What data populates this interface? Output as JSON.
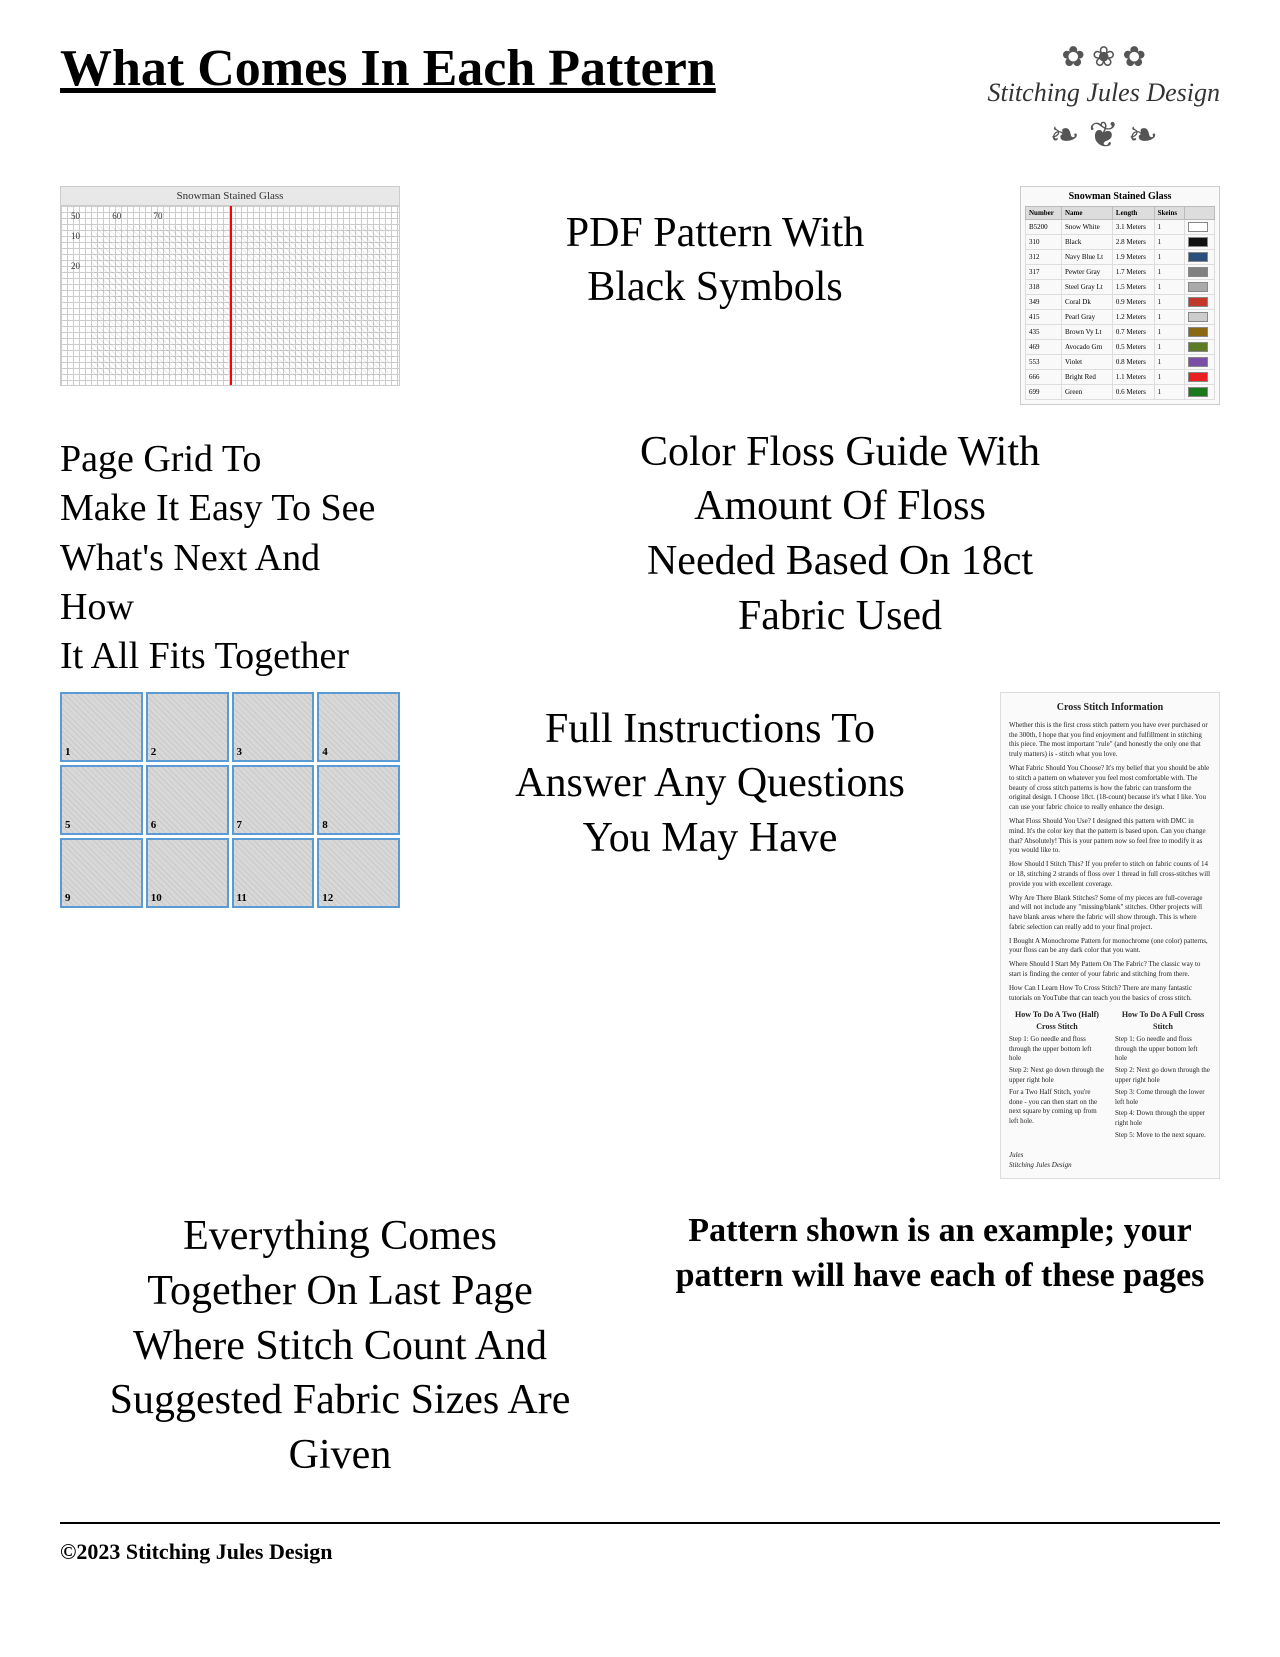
{
  "header": {
    "title": "What Comes In Each Pattern",
    "brand": {
      "name": "Stitching Jules Design",
      "decoration": "❧ ❦ ❧"
    }
  },
  "sections": {
    "pdf_pattern": {
      "label": "PDF Pattern With\nBlack Symbols",
      "preview_title": "Snowman Stained Glass"
    },
    "color_floss": {
      "label": "Color Floss Guide With\nAmount Of Floss\nNeeded Based On 18ct\nFabric Used"
    },
    "page_grid": {
      "label": "Page Grid To\nMake It Easy To See\nWhat's Next And How\nIt All Fits Together"
    },
    "instructions": {
      "label": "Full Instructions To\nAnswer Any Questions\nYou May Have"
    },
    "everything": {
      "label": "Everything Comes\nTogether On Last Page\nWhere Stitch Count And\nSuggested Fabric Sizes Are\nGiven"
    },
    "pattern_example": {
      "label": "Pattern shown is an example; your pattern will have each of these pages"
    }
  },
  "thumbnails": {
    "numbers": [
      "1",
      "2",
      "3",
      "4",
      "5",
      "6",
      "7",
      "8",
      "9",
      "10",
      "11",
      "12"
    ]
  },
  "floss_table": {
    "title": "Snowman Stained Glass",
    "headers": [
      "Number",
      "Name",
      "Length",
      "Skeins"
    ],
    "rows": [
      {
        "number": "B5200",
        "name": "Snow White",
        "length": "3.1 Meters",
        "skeins": "1",
        "color": "#ffffff"
      },
      {
        "number": "310",
        "name": "Black",
        "length": "2.8 Meters",
        "skeins": "1",
        "color": "#111111"
      },
      {
        "number": "312",
        "name": "Navy Blue Lt",
        "length": "1.9 Meters",
        "skeins": "1",
        "color": "#2a4f7c"
      },
      {
        "number": "317",
        "name": "Pewter Gray",
        "length": "1.7 Meters",
        "skeins": "1",
        "color": "#808080"
      },
      {
        "number": "318",
        "name": "Steel Gray Lt",
        "length": "1.5 Meters",
        "skeins": "1",
        "color": "#aaaaaa"
      },
      {
        "number": "349",
        "name": "Coral Dk",
        "length": "0.9 Meters",
        "skeins": "1",
        "color": "#c0392b"
      },
      {
        "number": "415",
        "name": "Pearl Gray",
        "length": "1.2 Meters",
        "skeins": "1",
        "color": "#cccccc"
      },
      {
        "number": "435",
        "name": "Brown Vy Lt",
        "length": "0.7 Meters",
        "skeins": "1",
        "color": "#8b6914"
      },
      {
        "number": "469",
        "name": "Avocado Grn",
        "length": "0.5 Meters",
        "skeins": "1",
        "color": "#5d7a27"
      },
      {
        "number": "553",
        "name": "Violet",
        "length": "0.8 Meters",
        "skeins": "1",
        "color": "#7b4fa6"
      },
      {
        "number": "666",
        "name": "Bright Red",
        "length": "1.1 Meters",
        "skeins": "1",
        "color": "#e82020"
      },
      {
        "number": "699",
        "name": "Green",
        "length": "0.6 Meters",
        "skeins": "1",
        "color": "#1a7a1a"
      }
    ]
  },
  "cross_stitch_info": {
    "title": "Cross Stitch Information",
    "paragraphs": [
      "Whether this is the first cross stitch pattern you have ever purchased or the 300th, I hope that you find enjoyment and fulfillment in stitching this piece. The most important \"rule\" (and honestly the only one that truly matters) is - stitch what you love.",
      "What Fabric Should You Choose? It's my belief that you should be able to stitch a pattern on whatever you feel most comfortable with. The beauty of cross stitch patterns is how the fabric can transform the original design. I Choose 18ct. (18-count) because it's what I like. You can use your fabric choice to really enhance the design.",
      "What Floss Should You Use? I designed this pattern with DMC in mind. It's the color key that the pattern is based upon. Can you change that? Absolutely! This is your pattern now so feel free to modify it as you would like to.",
      "How Should I Stitch This? If you prefer to stitch on fabric counts of 14 or 18, stitching 2 strands of floss over 1 thread in full cross-stitches will provide you with excellent coverage.",
      "Why Are There Blank Stitches? Some of my pieces are full-coverage and will not include any \"missing/blank\" stitches. Other projects will have blank areas where the fabric will show through. This is where fabric selection can really add to your final project.",
      "I Bought A Monochrome Pattern for monochrome (one color) patterns, your floss can be any dark color that you want.",
      "Where Should I Start My Pattern On The Fabric? The classic way to start is finding the center of your fabric and stitching from there.",
      "How Can I Learn How To Cross Stitch? There are many fantastic tutorials on YouTube that can teach you the basics of cross stitch."
    ],
    "half_stitch_title": "How To Do A Two (Half) Cross Stitch",
    "full_stitch_title": "How To Do A Full Cross Stitch",
    "steps_half": [
      "Step 1: Go needle and floss through the upper bottom left hole",
      "Step 2: Next go down through the upper right hole",
      "For a Two Half Stitch, you're done - you can then start on the next square by coming up from left hole."
    ],
    "steps_full": [
      "Step 1: Go needle and floss through the upper bottom left hole",
      "Step 2: Next go down through the upper right hole",
      "Step 3: Come through the lower left hole",
      "Step 4: Down through the upper right hole",
      "Step 5: Move to the next square."
    ],
    "signature": "Jules\nStitching Jules Design"
  },
  "footer": {
    "copyright": "©2023 Stitching Jules Design"
  }
}
